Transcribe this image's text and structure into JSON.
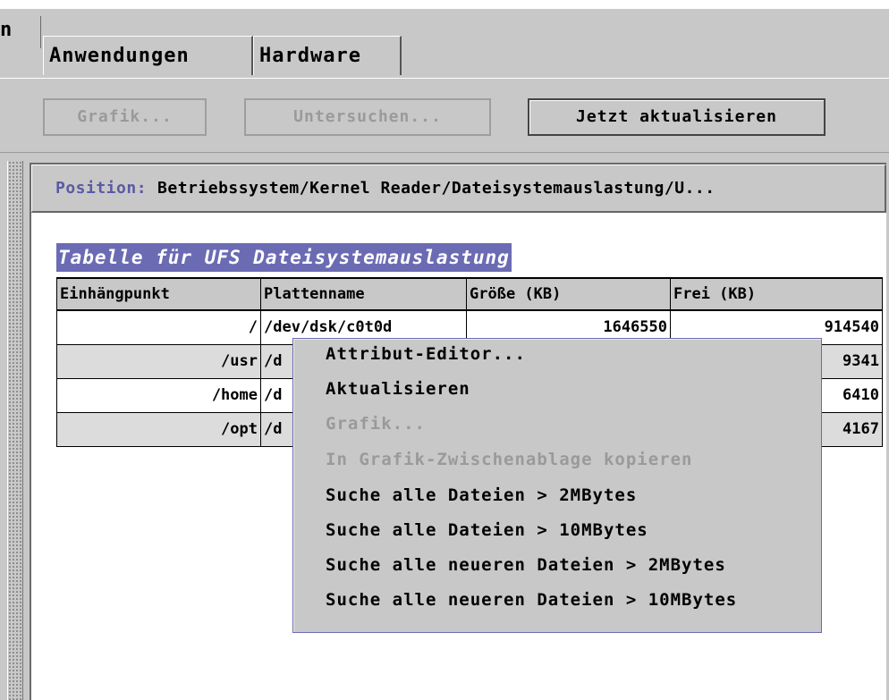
{
  "tabs": [
    {
      "label": "n"
    },
    {
      "label": "Anwendungen"
    },
    {
      "label": "Hardware"
    }
  ],
  "toolbar": {
    "graph_label": "Grafik...",
    "probe_label": "Untersuchen...",
    "refresh_label": "Jetzt aktualisieren"
  },
  "position": {
    "label": "Position:",
    "path": "Betriebssystem/Kernel Reader/Dateisystemauslastung/U..."
  },
  "table": {
    "title": "Tabelle für UFS Dateisystemauslastung",
    "columns": [
      "Einhängpunkt",
      "Plattenname",
      "Größe (KB)",
      "Frei (KB)"
    ],
    "rows": [
      {
        "mount": "/",
        "disk": "/dev/dsk/c0t0d",
        "size": "1646550",
        "free": "914540"
      },
      {
        "mount": "/usr",
        "disk": "/d",
        "size": "",
        "free": "9341"
      },
      {
        "mount": "/home",
        "disk": "/d",
        "size": "",
        "free": "6410"
      },
      {
        "mount": "/opt",
        "disk": "/d",
        "size": "",
        "free": "4167"
      }
    ]
  },
  "context_menu": {
    "items": [
      {
        "label": "Attribut-Editor...",
        "enabled": true
      },
      {
        "label": "Aktualisieren",
        "enabled": true
      },
      {
        "label": "Grafik...",
        "enabled": false
      },
      {
        "label": "In Grafik-Zwischenablage kopieren",
        "enabled": false
      },
      {
        "label": "Suche alle Dateien > 2MBytes",
        "enabled": true
      },
      {
        "label": "Suche alle Dateien > 10MBytes",
        "enabled": true
      },
      {
        "label": "Suche alle neueren Dateien > 2MBytes",
        "enabled": true
      },
      {
        "label": "Suche alle neueren Dateien > 10MBytes",
        "enabled": true
      }
    ]
  },
  "colors": {
    "accent": "#6b6bb4",
    "background": "#c8c8c8",
    "disabled_text": "#9a9a9a"
  }
}
